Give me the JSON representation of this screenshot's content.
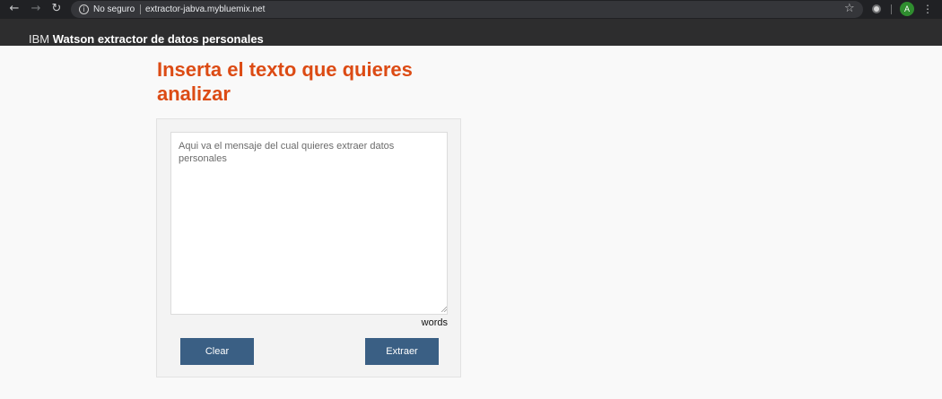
{
  "browser": {
    "security_label": "No seguro",
    "url": "extractor-jabva.mybluemix.net",
    "avatar_initial": "A",
    "icons": [
      "back-arrow-icon",
      "forward-arrow-icon",
      "reload-icon",
      "info-icon",
      "star-icon",
      "extension-icon",
      "kebab-menu-icon"
    ]
  },
  "header": {
    "brand": "IBM",
    "product": "Watson extractor de datos personales"
  },
  "main": {
    "heading": "Inserta el texto que quieres analizar",
    "textarea_placeholder": "Aqui va el mensaje del cual quieres extraer datos personales",
    "textarea_value": "",
    "words_label": "words",
    "clear_label": "Clear",
    "extract_label": "Extraer"
  },
  "colors": {
    "accent": "#dc4b14",
    "button": "#3a5f84",
    "header_bg": "#2d2d2e",
    "chrome_bg": "#202124"
  }
}
